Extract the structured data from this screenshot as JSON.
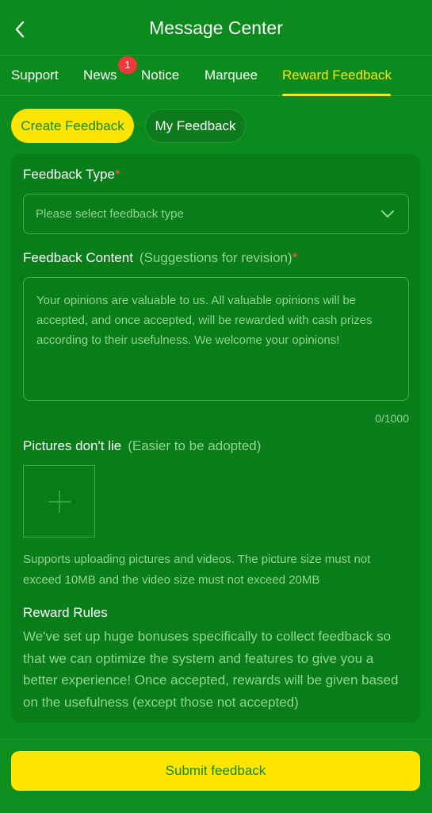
{
  "header": {
    "title": "Message Center",
    "back_icon": "chevron-left-icon"
  },
  "tabs": [
    {
      "label": "Support",
      "active": false
    },
    {
      "label": "News",
      "active": false,
      "badge": "1"
    },
    {
      "label": "Notice",
      "active": false
    },
    {
      "label": "Marquee",
      "active": false
    },
    {
      "label": "Reward Feedback",
      "active": true
    }
  ],
  "segment": {
    "create_label": "Create Feedback",
    "mine_label": "My Feedback"
  },
  "form": {
    "type_label": "Feedback Type",
    "required_mark": "*",
    "type_placeholder": "Please select feedback type",
    "content_label": "Feedback Content",
    "content_hint": "(Suggestions for revision)",
    "content_placeholder": "Your opinions are valuable to us. All valuable opinions will be accepted, and once accepted, will be rewarded with cash prizes according to their usefulness. We welcome your opinions!",
    "counter": "0/1000",
    "pictures_label": "Pictures don't lie",
    "pictures_hint": "(Easier to be adopted)",
    "upload_note": "Supports uploading pictures and videos. The picture size must not exceed 10MB and the video size must not exceed 20MB",
    "rules_title": "Reward Rules",
    "rules_text": "We've set up huge bonuses specifically to collect feedback so that we can optimize the system and features to give you a better experience! Once accepted, rewards will be given based on the usefulness (except those not accepted)"
  },
  "footer": {
    "submit_label": "Submit feedback"
  },
  "colors": {
    "background": "#0b8a1e",
    "accent": "#ffe500",
    "badge": "#ef3a3a",
    "hint_text": "#8fd68f"
  }
}
